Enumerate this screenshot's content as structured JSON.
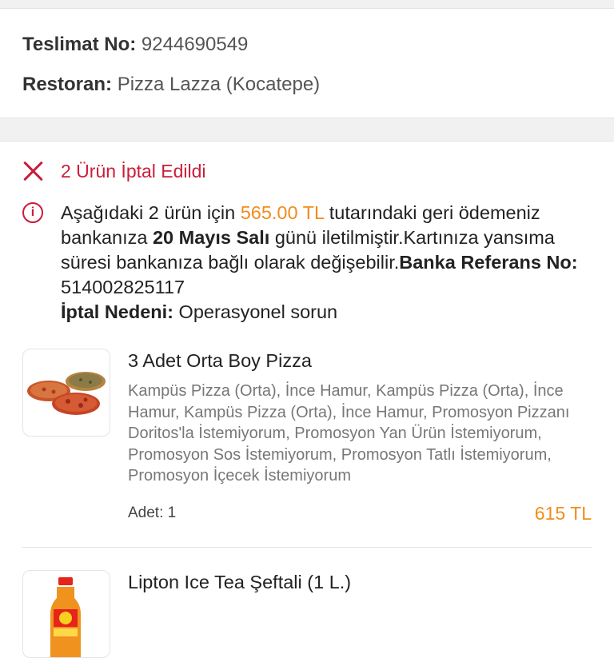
{
  "delivery": {
    "no_label": "Teslimat No:",
    "no_value": "9244690549",
    "restaurant_label": "Restoran:",
    "restaurant_value": "Pizza Lazza (Kocatepe)"
  },
  "cancellation": {
    "title": "2 Ürün İptal Edildi",
    "notice_part1": "Aşağıdaki 2 ürün için ",
    "refund_amount": "565.00 TL",
    "notice_part2": " tutarındaki geri ödemeniz bankanıza ",
    "refund_date": "20 Mayıs Salı",
    "notice_part3": " günü iletilmiştir.Kartınıza yansıma süresi bankanıza bağlı olarak değişebilir.",
    "bank_ref_label": "Banka Referans No:",
    "bank_ref_value": " 514002825117",
    "reason_label": "İptal Nedeni:",
    "reason_value": " Operasyonel sorun"
  },
  "items": [
    {
      "title": "3 Adet Orta Boy Pizza",
      "description": "Kampüs Pizza (Orta), İnce Hamur, Kampüs Pizza (Orta), İnce Hamur, Kampüs Pizza (Orta), İnce Hamur, Promosyon Pizzanı Doritos'la İstemiyorum, Promosyon Yan Ürün İstemiyorum, Promosyon Sos İstemiyorum, Promosyon Tatlı İstemiyorum, Promosyon İçecek İstemiyorum",
      "qty_label": "Adet:",
      "qty_value": "1",
      "price": "615 TL",
      "image": "pizza-image"
    },
    {
      "title": "Lipton Ice Tea Şeftali (1 L.)",
      "image": "ice-tea-bottle-image"
    }
  ],
  "colors": {
    "accent_red": "#cc1c3a",
    "price_orange": "#f28c1c"
  },
  "icons": {
    "cancel": "close-icon",
    "notice": "info-icon"
  }
}
